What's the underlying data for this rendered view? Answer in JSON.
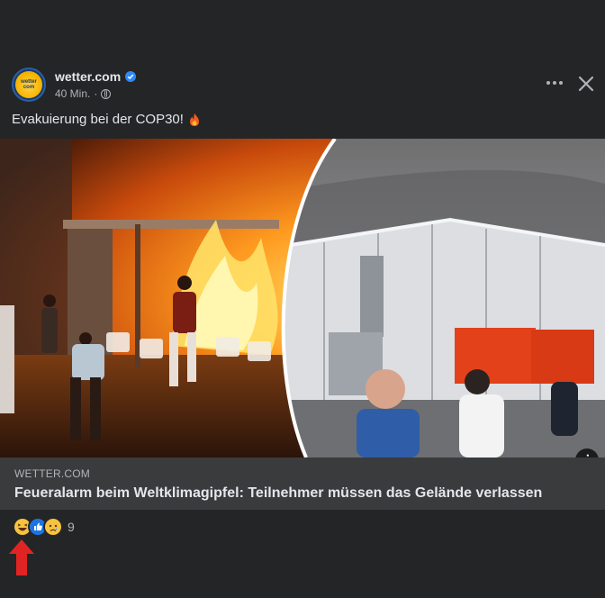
{
  "post": {
    "author": "wetter.com",
    "timestamp": "40 Min.",
    "caption": "Evakuierung bei der COP30!",
    "caption_emoji": "fire-emoji",
    "avatar_text_top": "wetter",
    "avatar_text_bottom": "com"
  },
  "link_preview": {
    "domain": "WETTER.COM",
    "title": "Feueralarm beim Weltklimagipfel: Teilnehmer müssen das Gelände verlassen",
    "info_label": "i"
  },
  "reactions": {
    "types": [
      "haha",
      "like",
      "sad"
    ],
    "count": "9"
  },
  "colors": {
    "background": "#242526",
    "link_box": "#3a3b3c",
    "verified_blue": "#2d88ff",
    "annotation_arrow": "#e02424"
  },
  "icons": [
    "verified-badge-icon",
    "globe-icon",
    "more-options-icon",
    "close-icon",
    "info-icon",
    "red-arrow-annotation"
  ]
}
